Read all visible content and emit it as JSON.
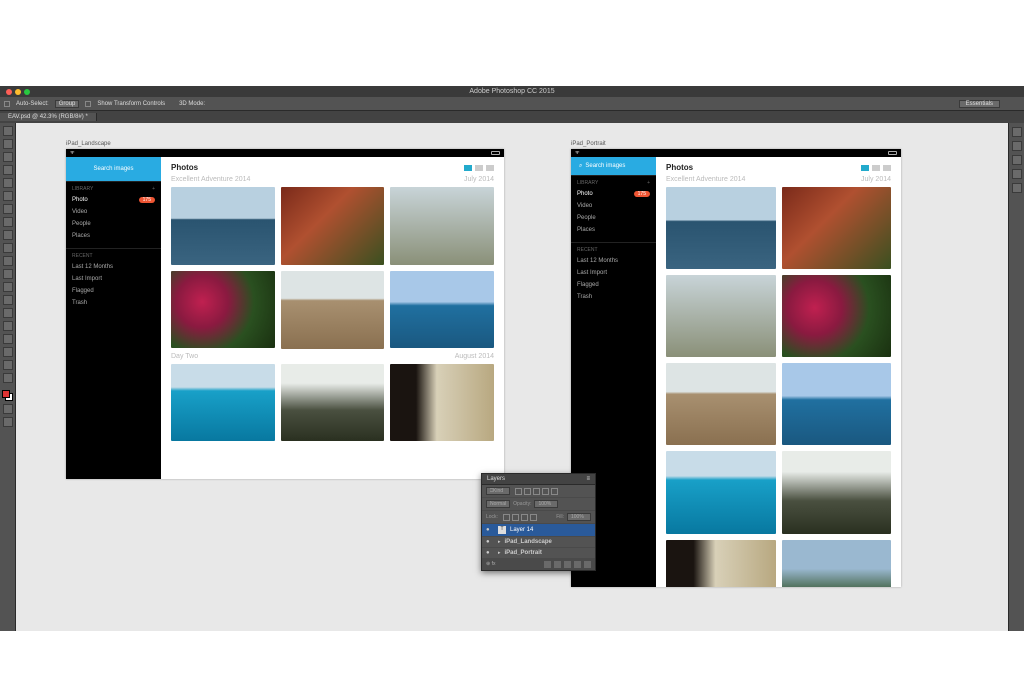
{
  "app": {
    "title": "Adobe Photoshop CC 2015",
    "workspace": "Essentials"
  },
  "options_bar": {
    "auto_select_label": "Auto-Select:",
    "auto_select_value": "Group",
    "show_transform_label": "Show Transform Controls",
    "mode_label": "3D Mode:"
  },
  "document_tab": "EAV.psd @ 42.3% (RGB/8#) *",
  "artboards": {
    "landscape": {
      "label": "iPad_Landscape"
    },
    "portrait": {
      "label": "iPad_Portrait"
    }
  },
  "ipad": {
    "search_label": "Search images",
    "page_title": "Photos",
    "library_header": "LIBRARY",
    "recent_header": "RECENT",
    "library_items": [
      {
        "label": "Photo",
        "badge": "175",
        "active": true
      },
      {
        "label": "Video"
      },
      {
        "label": "People"
      },
      {
        "label": "Places"
      }
    ],
    "recent_items": [
      {
        "label": "Last 12 Months"
      },
      {
        "label": "Last Import"
      },
      {
        "label": "Flagged"
      },
      {
        "label": "Trash"
      }
    ],
    "sections": [
      {
        "title": "Excellent Adventure 2014",
        "date": "July 2014"
      },
      {
        "title": "Day Two",
        "date": "August 2014"
      }
    ]
  },
  "layers_panel": {
    "title": "Layers",
    "filter_label": "Kind",
    "blend_mode": "Normal",
    "opacity_label": "Opacity:",
    "opacity_value": "100%",
    "lock_label": "Lock:",
    "fill_label": "Fill:",
    "fill_value": "100%",
    "layers": [
      {
        "name": "Layer 14",
        "type": "text",
        "selected": true
      },
      {
        "name": "iPad_Landscape",
        "type": "artboard"
      },
      {
        "name": "iPad_Portrait",
        "type": "artboard"
      }
    ]
  }
}
